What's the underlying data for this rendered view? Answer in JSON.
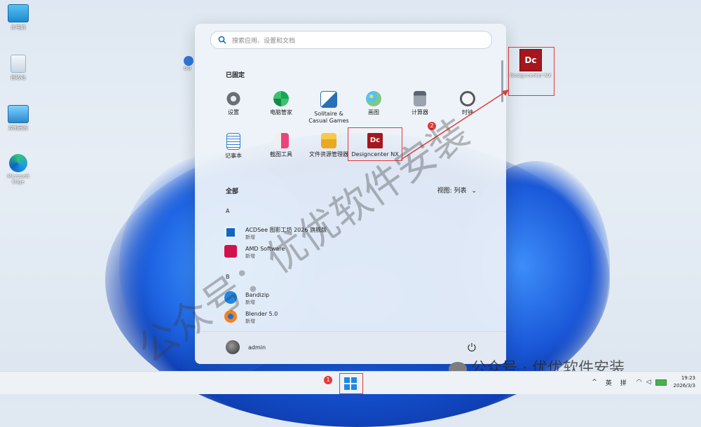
{
  "desktop": {
    "icons": [
      {
        "label": "此电脑",
        "icon": "monitor-icon"
      },
      {
        "label": "回收站",
        "icon": "recycle-bin-icon"
      },
      {
        "label": "控制面板",
        "icon": "control-panel-icon"
      },
      {
        "label": "Microsoft Edge",
        "icon": "edge-icon"
      }
    ],
    "partial_icon_label": "UG",
    "designcenter_label": "Designcenter NX",
    "badge_2": "2"
  },
  "start_menu": {
    "search_placeholder": "搜索应用、设置和文档",
    "pinned_title": "已固定",
    "pinned": [
      {
        "label": "设置",
        "icon": "gear-icon"
      },
      {
        "label": "电脑管家",
        "icon": "pc-manager-icon"
      },
      {
        "label": "Solitaire & Casual Games",
        "icon": "cards-icon"
      },
      {
        "label": "画图",
        "icon": "paint-icon"
      },
      {
        "label": "计算器",
        "icon": "calculator-icon"
      },
      {
        "label": "时钟",
        "icon": "clock-icon"
      },
      {
        "label": "记事本",
        "icon": "notepad-icon"
      },
      {
        "label": "截图工具",
        "icon": "snipping-icon"
      },
      {
        "label": "文件资源管理器",
        "icon": "folder-icon"
      },
      {
        "label": "Designcenter NX",
        "icon": "dc-icon"
      }
    ],
    "all_title": "全部",
    "view_label": "视图: 列表",
    "groups": [
      {
        "letter": "A",
        "items": [
          {
            "name": "ACDSee 图影工坊 2026 旗舰版",
            "sub": "新增",
            "icon": "acdsee-icon"
          },
          {
            "name": "AMD Software",
            "sub": "新增",
            "icon": "amd-icon"
          }
        ]
      },
      {
        "letter": "B",
        "items": [
          {
            "name": "Bandizip",
            "sub": "新增",
            "icon": "bandizip-icon"
          },
          {
            "name": "Blender 5.0",
            "sub": "新增",
            "icon": "blender-icon"
          }
        ]
      }
    ],
    "user": "admin"
  },
  "taskbar": {
    "badge_1": "1",
    "tray_lang": "英",
    "tray_ime": "拼",
    "time": "19:23",
    "date": "2026/3/3"
  },
  "watermark": {
    "diagonal": "公众号：优优软件安装",
    "bottom": "公众号 · 优优软件安装"
  },
  "colors": {
    "accent": "#0067c0",
    "annotation": "#e03a3a",
    "dc_red": "#a4171d"
  }
}
